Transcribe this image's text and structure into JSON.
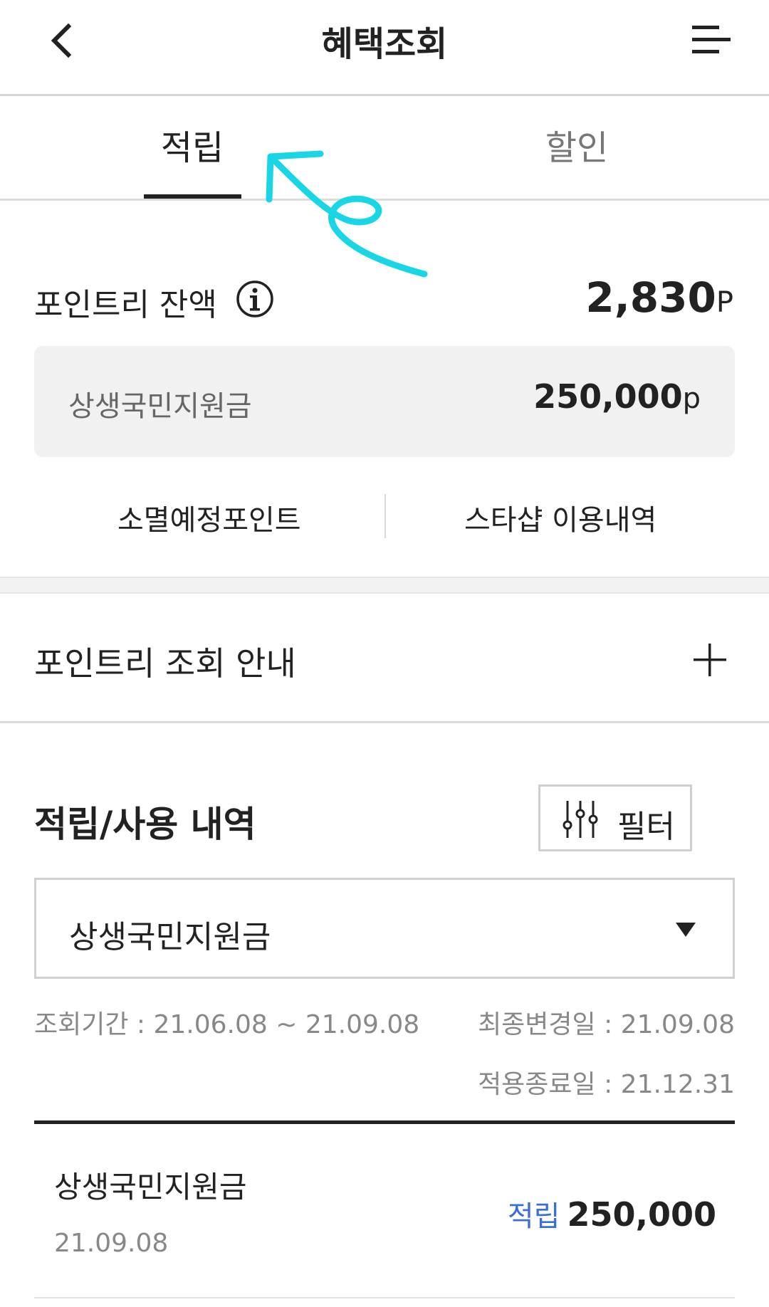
{
  "header": {
    "title": "혜택조회",
    "back_icon": "chevron-left-icon",
    "menu_icon": "hamburger-menu-icon"
  },
  "tabs": [
    {
      "label": "적립",
      "active": true
    },
    {
      "label": "할인",
      "active": false
    }
  ],
  "balance": {
    "label": "포인트리 잔액",
    "amount": "2,830",
    "unit": "P",
    "info_icon": "info-icon"
  },
  "sub_balance": {
    "label": "상생국민지원금",
    "amount": "250,000",
    "unit": "p"
  },
  "links": {
    "expire": "소멸예정포인트",
    "starshop": "스타샵 이용내역"
  },
  "guide": {
    "label": "포인트리 조회 안내",
    "icon": "plus-icon"
  },
  "history": {
    "title": "적립/사용 내역",
    "filter_label": "필터",
    "filter_icon": "sliders-icon",
    "select_value": "상생국민지원금",
    "period": "조회기간 : 21.06.08 ~ 21.09.08",
    "last_changed": "최종변경일 : 21.09.08",
    "end_date": "적용종료일 : 21.12.31",
    "items": [
      {
        "name": "상생국민지원금",
        "date": "21.09.08",
        "type": "적립",
        "amount": "250,000"
      }
    ]
  },
  "colors": {
    "accent_blue": "#3b6fd8",
    "annotation_cyan": "#19d6e6",
    "text_dark": "#222222",
    "text_gray": "#888888",
    "panel_gray": "#f1f1f1"
  }
}
